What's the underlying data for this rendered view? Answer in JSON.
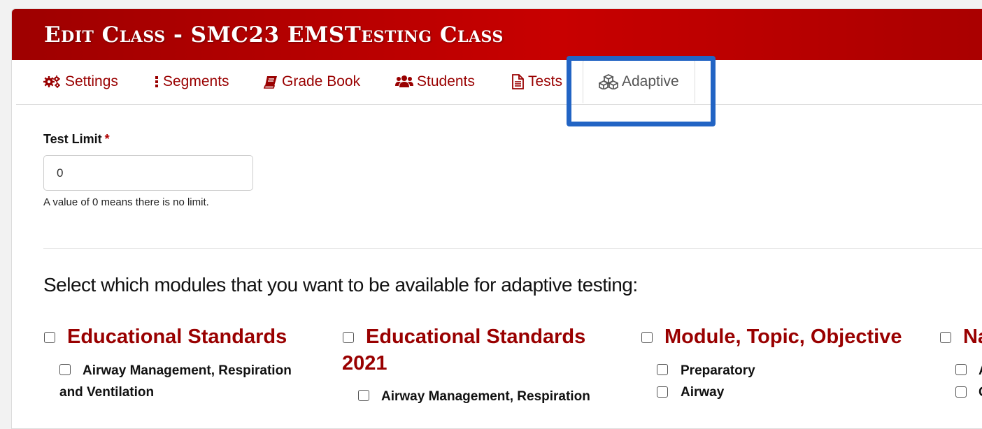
{
  "header": {
    "title": "Edit Class - SMC23 EMSTesting Class"
  },
  "tabs": [
    {
      "label": "Settings",
      "icon": "gears-icon"
    },
    {
      "label": "Segments",
      "icon": "ellipsis-vertical-icon"
    },
    {
      "label": "Grade Book",
      "icon": "book-icon"
    },
    {
      "label": "Students",
      "icon": "users-icon"
    },
    {
      "label": "Tests",
      "icon": "file-text-icon"
    },
    {
      "label": "Adaptive",
      "icon": "cubes-icon",
      "active": true
    }
  ],
  "form": {
    "test_limit_label": "Test Limit",
    "required_marker": "*",
    "test_limit_value": "0",
    "help_text": "A value of 0 means there is no limit."
  },
  "modules": {
    "prompt": "Select which modules that you want to be available for adaptive testing:",
    "columns": [
      {
        "title": "Educational Standards",
        "items": [
          "Airway Management, Respiration",
          "and Ventilation"
        ]
      },
      {
        "title_line1": "Educational Standards",
        "title_line2": "2021",
        "items": [
          "Airway Management, Respiration"
        ]
      },
      {
        "title": "Module, Topic, Objective",
        "items": [
          "Preparatory",
          "Airway"
        ]
      },
      {
        "title": "Na",
        "items": [
          "A",
          "C"
        ]
      }
    ]
  },
  "colors": {
    "brand_red": "#c80000",
    "link_red": "#990000",
    "highlight_blue": "#2264c4"
  }
}
